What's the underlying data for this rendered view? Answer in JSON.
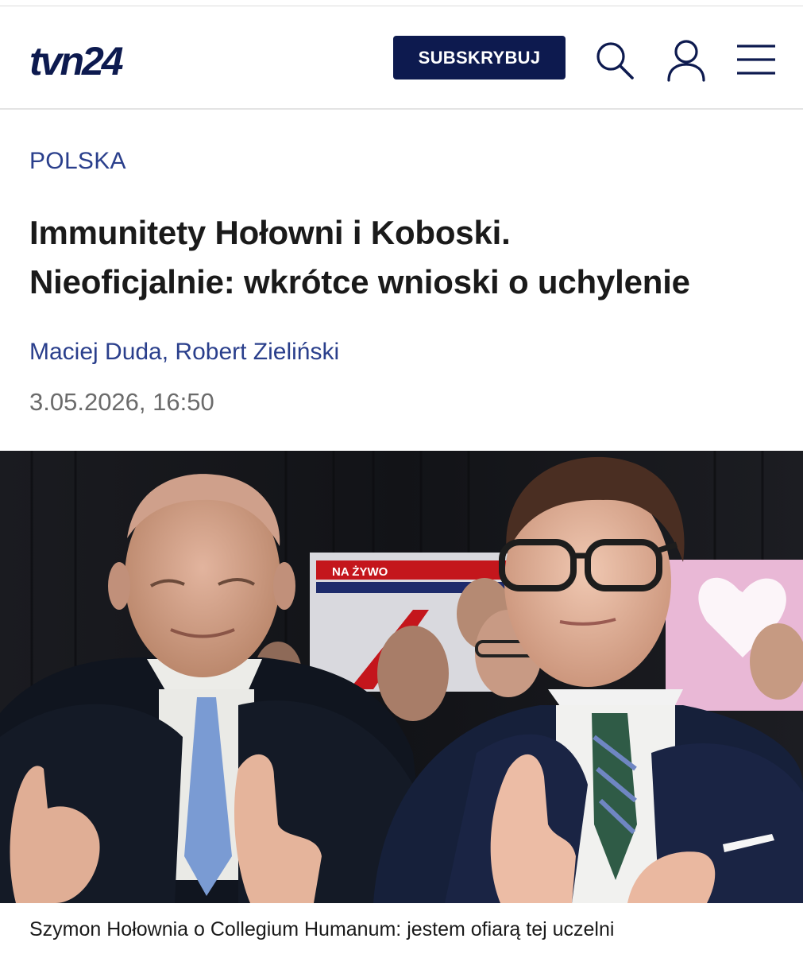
{
  "header": {
    "logo_text": "tvn24",
    "subscribe_label": "SUBSKRYBUJ",
    "icons": [
      "search-icon",
      "user-icon",
      "menu-icon"
    ],
    "brand_color": "#0d1a4f"
  },
  "article": {
    "category": "POLSKA",
    "title_line1": "Immunitety Hołowni i Koboski.",
    "title_line2": "Nieoficjalnie: wkrótce wnioski o uchylenie",
    "authors": [
      "Maciej Duda",
      "Robert Zieliński"
    ],
    "author_separator": ", ",
    "date": "3.05.2026, 16:50",
    "link_color": "#2a3f8c"
  },
  "photo": {
    "screen_text": "NA ŻYWO",
    "caption": "Szymon Hołownia o Collegium Humanum: jestem ofiarą tej uczelni"
  }
}
